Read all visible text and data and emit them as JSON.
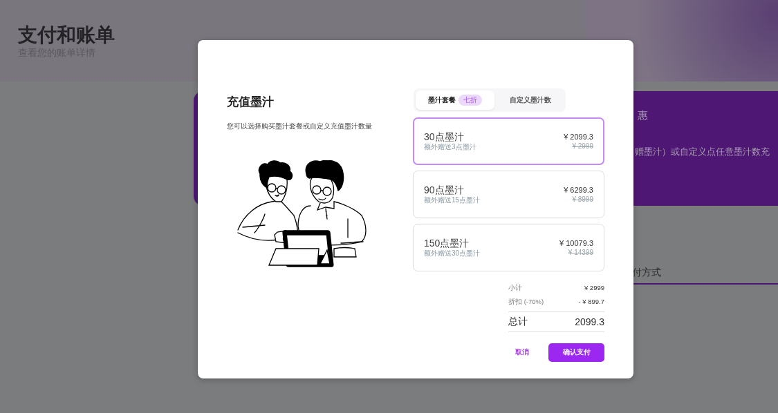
{
  "page": {
    "title": "支付和账单",
    "subtitle": "查看您的账单详情"
  },
  "background": {
    "banner_texts": [
      "惠",
      "赠墨汁）或自定义点任意墨汁数充"
    ],
    "tab_label": "付方式"
  },
  "dialog": {
    "title": "充值墨汁",
    "description": "您可以选择购买墨汁套餐或自定义充值墨汁数量",
    "tabs": [
      {
        "label": "墨汁套餐",
        "badge": "七折",
        "selected": true
      },
      {
        "label": "自定义墨汁数",
        "selected": false
      }
    ],
    "packages": [
      {
        "name": "30点墨汁",
        "bonus": "额外赠送3点墨汁",
        "price": "¥ 2099.3",
        "original_price": "¥ 2999",
        "selected": true
      },
      {
        "name": "90点墨汁",
        "bonus": "额外赠送15点墨汁",
        "price": "¥ 6299.3",
        "original_price": "¥ 8999",
        "selected": false
      },
      {
        "name": "150点墨汁",
        "bonus": "额外赠送30点墨汁",
        "price": "¥ 10079.3",
        "original_price": "¥ 14399",
        "selected": false
      }
    ],
    "summary": {
      "subtotal_label": "小计",
      "subtotal": "¥ 2999",
      "discount_label": "折扣 (-70%)",
      "discount": "- ¥ 899.7",
      "total_label": "总计",
      "total": "2099.3"
    },
    "buttons": {
      "cancel": "取消",
      "confirm": "确认支付"
    }
  }
}
